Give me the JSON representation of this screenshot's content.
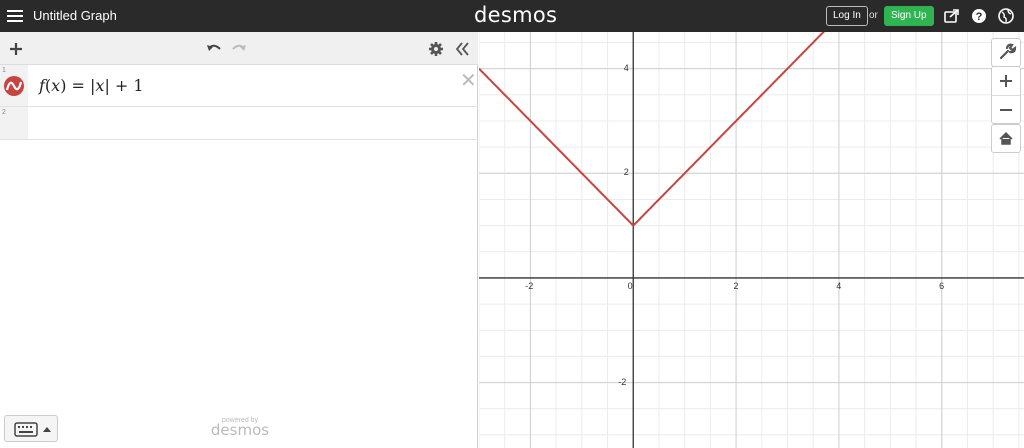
{
  "header": {
    "title": "Untitled Graph",
    "brand": "desmos",
    "login_label": "Log In",
    "or_label": "or",
    "signup_label": "Sign Up"
  },
  "icons": {
    "menu": "hamburger-menu-icon",
    "share": "share-icon",
    "help": "help-icon",
    "language": "globe-icon",
    "add": "plus-icon",
    "undo": "undo-icon",
    "redo": "redo-icon",
    "settings": "gear-icon",
    "collapse": "double-chevron-left-icon",
    "keyboard": "keyboard-icon",
    "wrench": "wrench-icon",
    "zoom_in": "plus-icon",
    "zoom_out": "minus-icon",
    "home": "home-icon"
  },
  "expressions": [
    {
      "number": "1",
      "func_name": "f",
      "var": "x",
      "rhs_var": "x",
      "constant": "1",
      "color": "#c74440"
    },
    {
      "number": "2"
    }
  ],
  "footer": {
    "powered_by": "powered by",
    "brand": "desmos"
  },
  "graph": {
    "x_range": [
      -3,
      7.6
    ],
    "y_range": [
      -3.25,
      4.7
    ],
    "x_ticks": [
      "-2",
      "0",
      "2",
      "4",
      "6"
    ],
    "y_ticks": [
      "4",
      "2",
      "-2"
    ],
    "curve_color": "#c74440"
  },
  "colors": {
    "topbar": "#2a2a2a",
    "signup": "#2eb450",
    "curve": "#c74440"
  }
}
